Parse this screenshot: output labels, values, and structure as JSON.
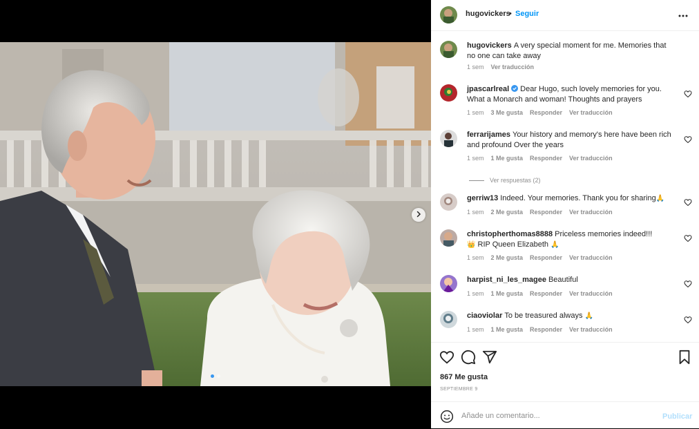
{
  "post": {
    "author": "hugovickers",
    "bullet": "•",
    "follow_label": "Seguir",
    "more_icon": "more-horizontal-icon",
    "next_icon": "chevron-right-icon",
    "carousel_count": 2,
    "carousel_active": 1
  },
  "caption": {
    "user": "hugovickers",
    "text": "A very special moment for me. Memories that no one can take away",
    "time": "1 sem",
    "translate": "Ver traducción"
  },
  "comments": [
    {
      "user": "jpascarlreal",
      "verified": true,
      "text": "Dear Hugo, such lovely memories for you. What a Monarch and woman! Thoughts and prayers",
      "time": "1 sem",
      "likes": "3 Me gusta",
      "reply": "Responder",
      "translate": "Ver traducción"
    },
    {
      "user": "ferrarijames",
      "verified": false,
      "text": "Your history and memory's here have been rich and profound Over the years",
      "time": "1 sem",
      "likes": "1 Me gusta",
      "reply": "Responder",
      "translate": "Ver traducción",
      "view_replies": "Ver respuestas (2)"
    },
    {
      "user": "gerriw13",
      "verified": false,
      "text": "Indeed. Your memories. Thank you for sharing",
      "emoji": "🙏",
      "time": "1 sem",
      "likes": "2 Me gusta",
      "reply": "Responder",
      "translate": "Ver traducción"
    },
    {
      "user": "christopherthomas8888",
      "verified": false,
      "text": "Priceless memories indeed!!!",
      "crown": "👑",
      "text2": "RIP Queen Elizabeth",
      "emoji": "🙏",
      "time": "1 sem",
      "likes": "2 Me gusta",
      "reply": "Responder",
      "translate": "Ver traducción"
    },
    {
      "user": "harpist_ni_les_magee",
      "verified": false,
      "text": "Beautiful",
      "time": "1 sem",
      "likes": "1 Me gusta",
      "reply": "Responder",
      "translate": "Ver traducción"
    },
    {
      "user": "ciaoviolar",
      "verified": false,
      "text": "To be treasured always",
      "emoji": "🙏",
      "time": "1 sem",
      "likes": "1 Me gusta",
      "reply": "Responder",
      "translate": "Ver traducción"
    }
  ],
  "actions": {
    "icons": [
      "heart-icon",
      "comment-icon",
      "share-icon",
      "bookmark-icon"
    ],
    "likes": "867 Me gusta",
    "date": "SEPTIEMBRE 9"
  },
  "composer": {
    "placeholder": "Añade un comentario...",
    "publish": "Publicar",
    "emoji_icon": "smiley-icon"
  },
  "colors": {
    "link": "#0095f6",
    "muted": "#8e8e8e",
    "publish_disabled": "#b2dffc",
    "verified": "#3897f0"
  }
}
